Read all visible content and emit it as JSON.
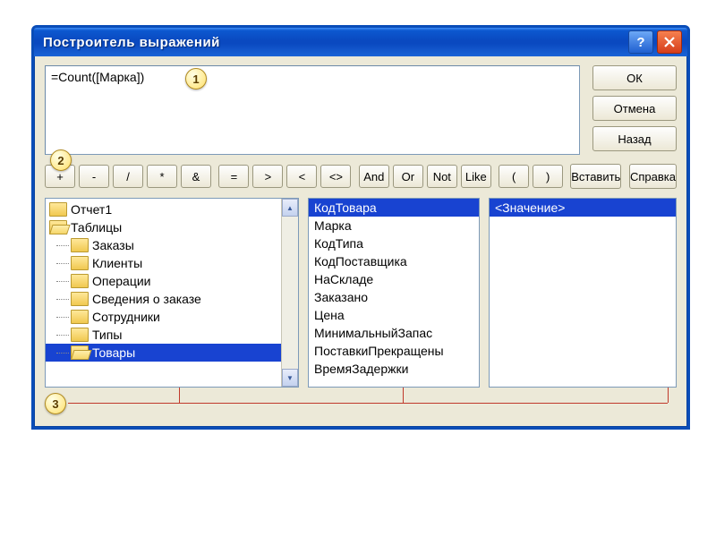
{
  "title": "Построитель выражений",
  "expression": "=Count([Марка])",
  "buttons": {
    "ok": "ОК",
    "cancel": "Отмена",
    "back": "Назад",
    "help": "Справка",
    "insert": "Вставить"
  },
  "operators": [
    "+",
    "-",
    "/",
    "*",
    "&",
    "=",
    ">",
    "<",
    "<>",
    "And",
    "Or",
    "Not",
    "Like",
    "(",
    ")"
  ],
  "tree": {
    "root1": "Отчет1",
    "root2": "Таблицы",
    "children": [
      "Заказы",
      "Клиенты",
      "Операции",
      "Сведения о заказе",
      "Сотрудники",
      "Типы",
      "Товары"
    ],
    "selected": "Товары"
  },
  "fields": {
    "items": [
      "КодТовара",
      "Марка",
      "КодТипа",
      "КодПоставщика",
      "НаСкладе",
      "Заказано",
      "Цена",
      "МинимальныйЗапас",
      "ПоставкиПрекращены",
      "ВремяЗадержки"
    ],
    "selected": "КодТовара"
  },
  "valuePanel": {
    "items": [
      "<Значение>"
    ],
    "selected": "<Значение>"
  },
  "callouts": {
    "c1": "1",
    "c2": "2",
    "c3": "3"
  }
}
